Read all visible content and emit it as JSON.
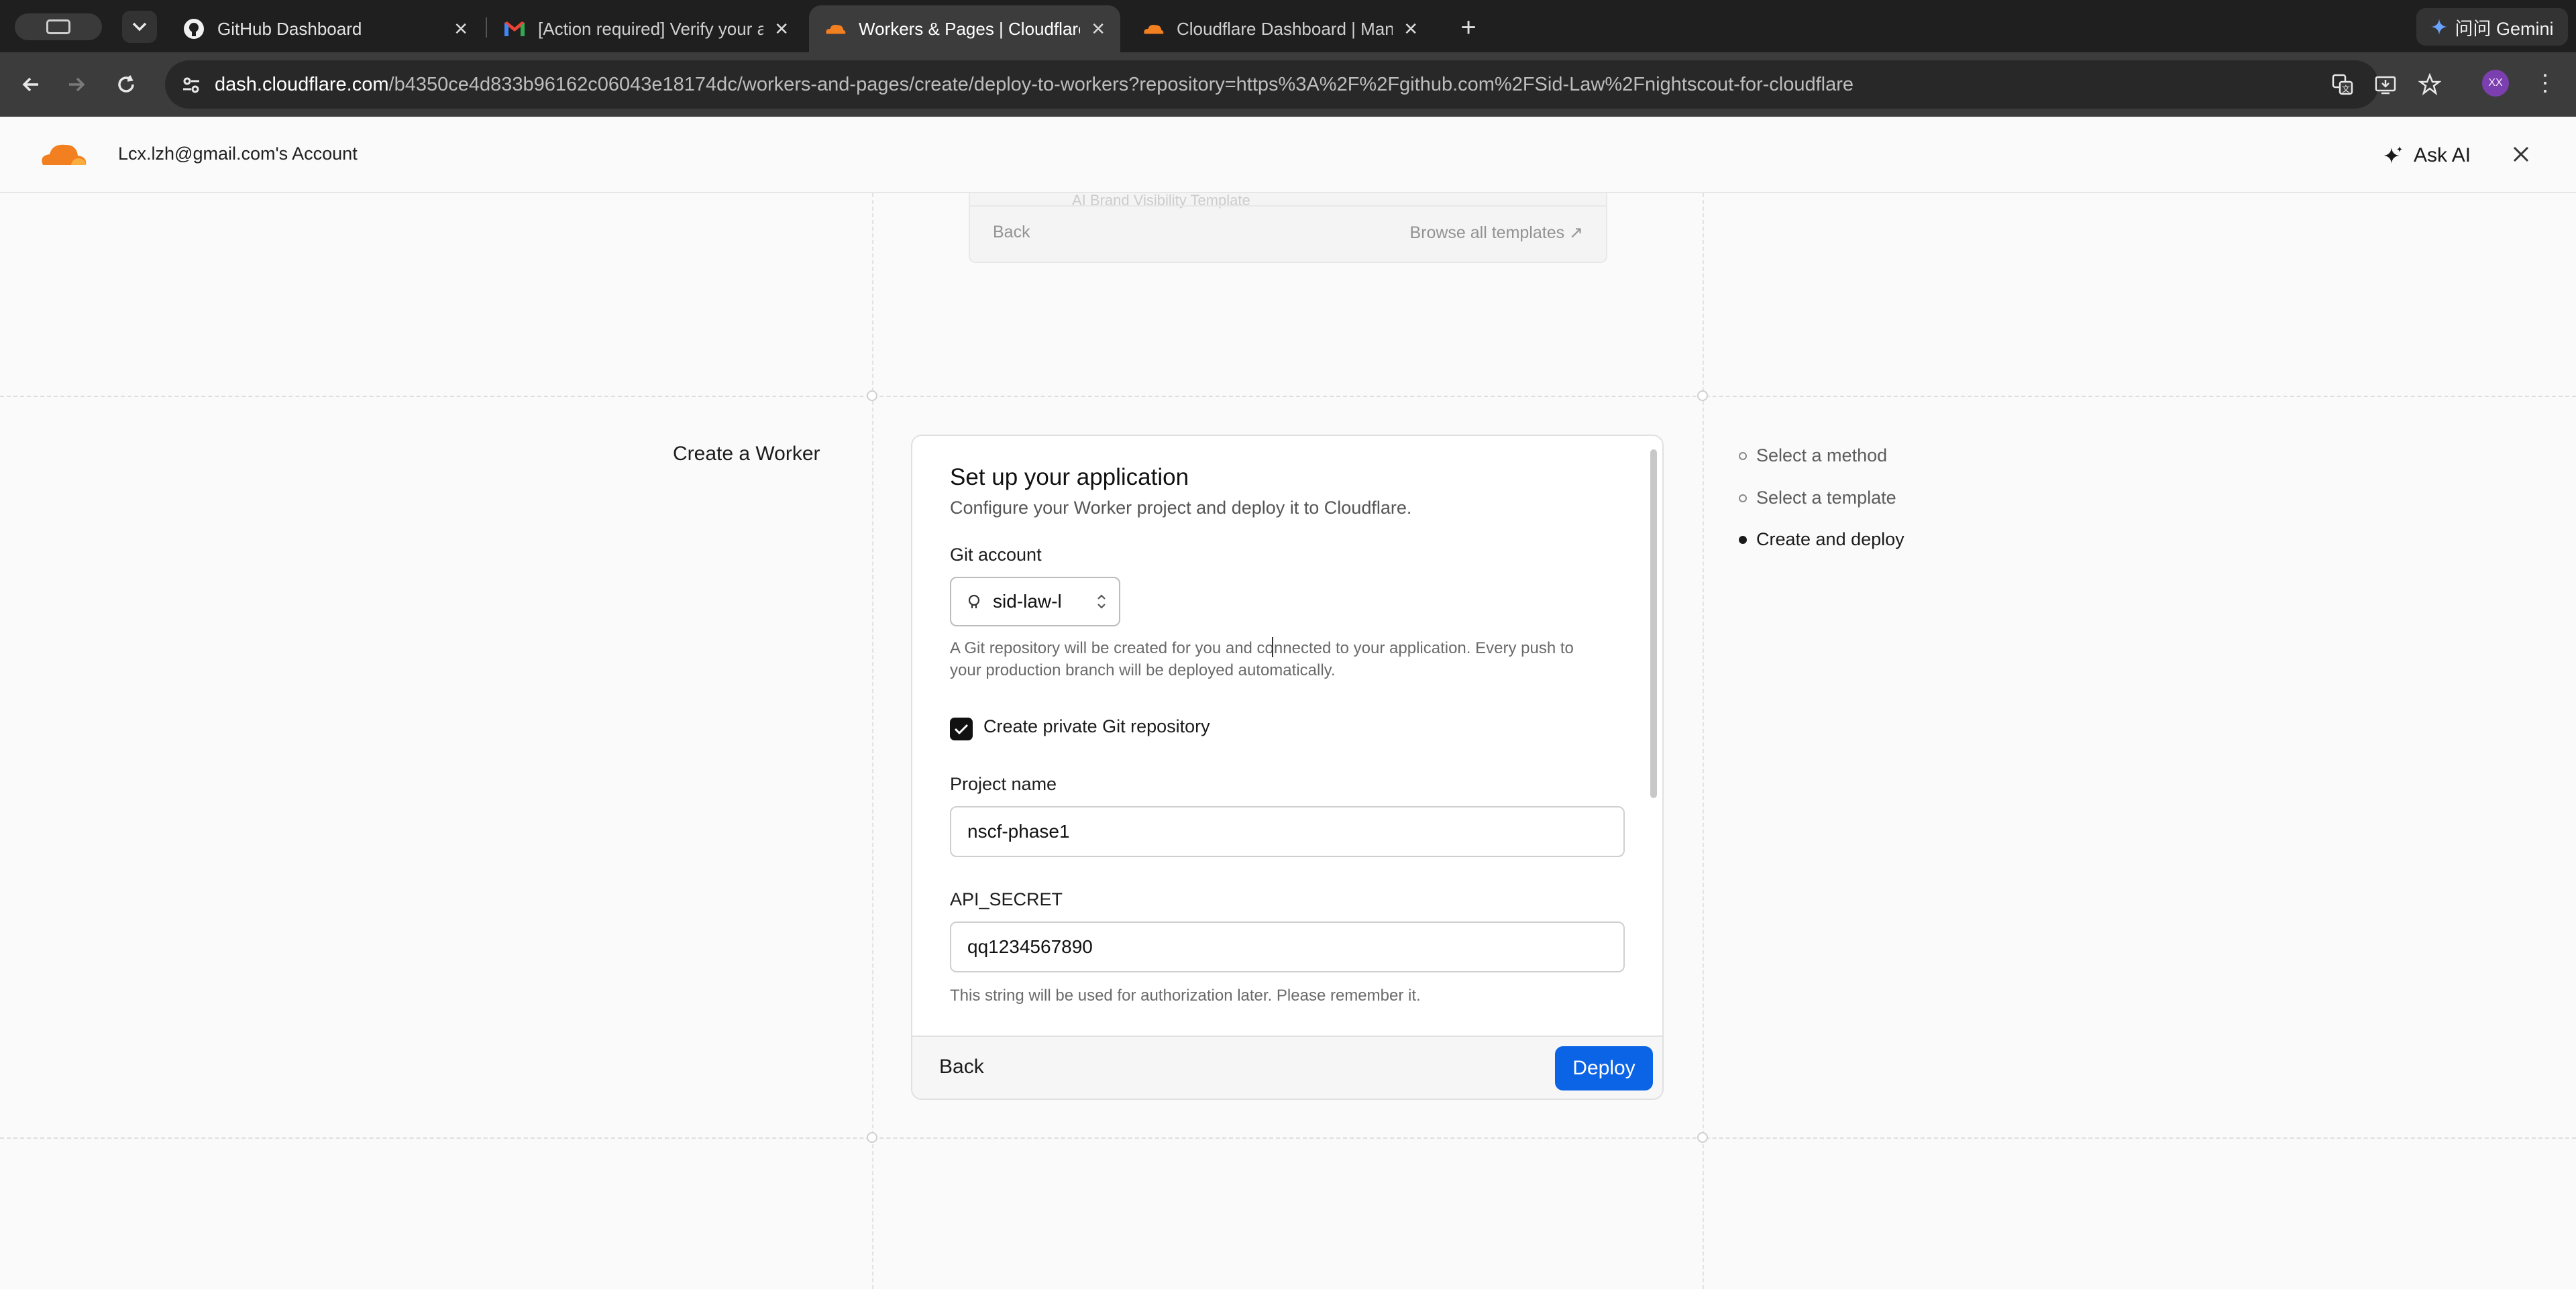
{
  "browser": {
    "tabs": [
      {
        "title": "GitHub Dashboard",
        "icon": "github-icon"
      },
      {
        "title": "[Action required] Verify your a",
        "icon": "gmail-icon"
      },
      {
        "title": "Workers & Pages | Cloudflare",
        "icon": "cloudflare-icon",
        "active": true
      },
      {
        "title": "Cloudflare Dashboard | Mana",
        "icon": "cloudflare-icon"
      }
    ],
    "gemini_label": "问问 Gemini",
    "url_host": "dash.cloudflare.com",
    "url_path": "/b4350ce4d833b96162c06043e18174dc/workers-and-pages/create/deploy-to-workers?repository=https%3A%2F%2Fgithub.com%2FSid-Law%2Fnightscout-for-cloudflare",
    "avatar_initials": "XX"
  },
  "header": {
    "account": "Lcx.lzh@gmail.com's Account",
    "ask_ai": "Ask AI"
  },
  "previous_card": {
    "ghost_text": "AI Brand Visibility Template",
    "back": "Back",
    "browse": "Browse all templates ↗"
  },
  "page": {
    "section_title": "Create a Worker"
  },
  "form": {
    "title": "Set up your application",
    "subtitle": "Configure your Worker project and deploy it to Cloudflare.",
    "git_account_label": "Git account",
    "git_account_value": "sid-law-l",
    "git_help_1": "A Git repository will be created for you and connected to your application. Every push to",
    "git_help_2": "your production branch will be deployed automatically.",
    "private_repo_label": "Create private Git repository",
    "private_repo_checked": true,
    "project_name_label": "Project name",
    "project_name_value": "nscf-phase1",
    "api_secret_label": "API_SECRET",
    "api_secret_value": "qq1234567890",
    "api_secret_help": "This string will be used for authorization later. Please remember it.",
    "back": "Back",
    "deploy": "Deploy"
  },
  "steps": [
    {
      "label": "Select a method",
      "current": false
    },
    {
      "label": "Select a template",
      "current": false
    },
    {
      "label": "Create and deploy",
      "current": true
    }
  ],
  "colors": {
    "accent": "#0b63e5",
    "cloudflare_orange": "#f38020"
  }
}
